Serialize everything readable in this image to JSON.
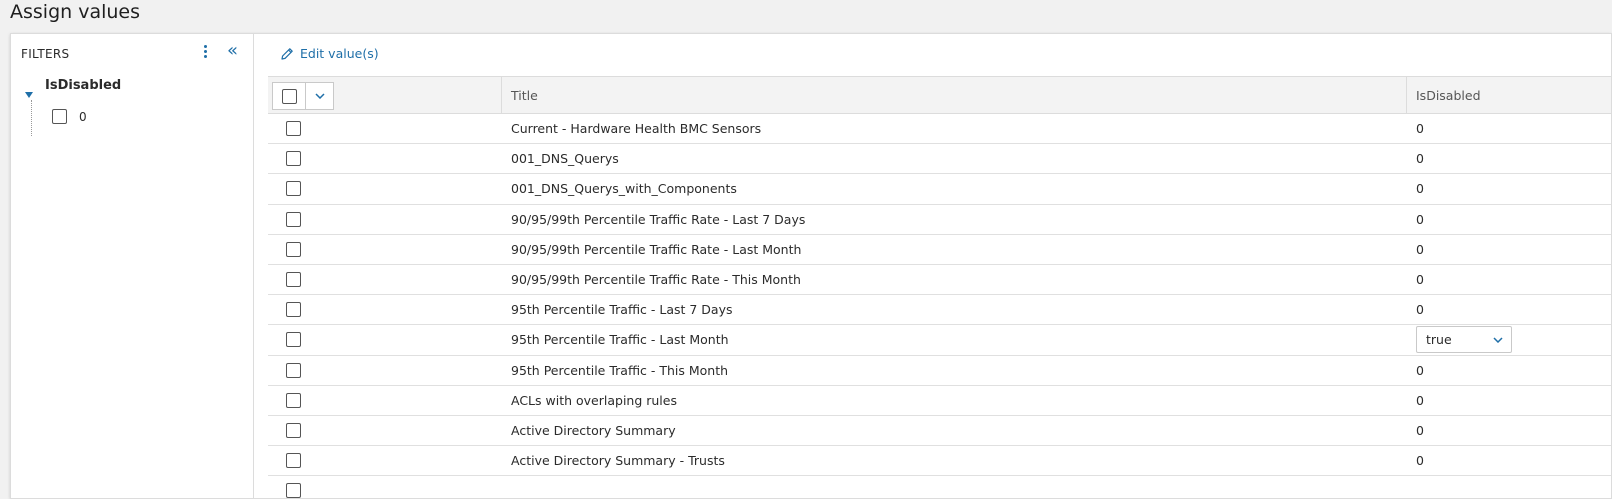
{
  "page": {
    "title": "Assign values"
  },
  "filters": {
    "title": "FILTERS",
    "group": {
      "label": "IsDisabled",
      "options": [
        {
          "label": "0"
        }
      ]
    }
  },
  "toolbar": {
    "edit_label": "Edit value(s)"
  },
  "grid": {
    "columns": {
      "title": "Title",
      "isdisabled": "IsDisabled"
    },
    "rows": [
      {
        "title": "Current - Hardware Health BMC Sensors",
        "value": "0"
      },
      {
        "title": "001_DNS_Querys",
        "value": "0"
      },
      {
        "title": "001_DNS_Querys_with_Components",
        "value": "0"
      },
      {
        "title": "90/95/99th Percentile Traffic Rate - Last 7 Days",
        "value": "0"
      },
      {
        "title": "90/95/99th Percentile Traffic Rate - Last Month",
        "value": "0"
      },
      {
        "title": "90/95/99th Percentile Traffic Rate - This Month",
        "value": "0"
      },
      {
        "title": "95th Percentile Traffic - Last 7 Days",
        "value": "0"
      },
      {
        "title": "95th Percentile Traffic - Last Month",
        "value": "true"
      },
      {
        "title": "95th Percentile Traffic - This Month",
        "value": "0"
      },
      {
        "title": "ACLs with overlaping rules",
        "value": "0"
      },
      {
        "title": "Active Directory Summary",
        "value": "0"
      },
      {
        "title": "Active Directory Summary - Trusts",
        "value": "0"
      }
    ]
  },
  "colors": {
    "accent": "#1f6fa8",
    "border": "#dcdcdc",
    "header_bg": "#f3f3f3"
  },
  "icons": {
    "edit": "pencil-icon",
    "collapse": "double-chevron-left-icon",
    "menu": "kebab-icon",
    "dropdown": "chevron-down-icon"
  }
}
